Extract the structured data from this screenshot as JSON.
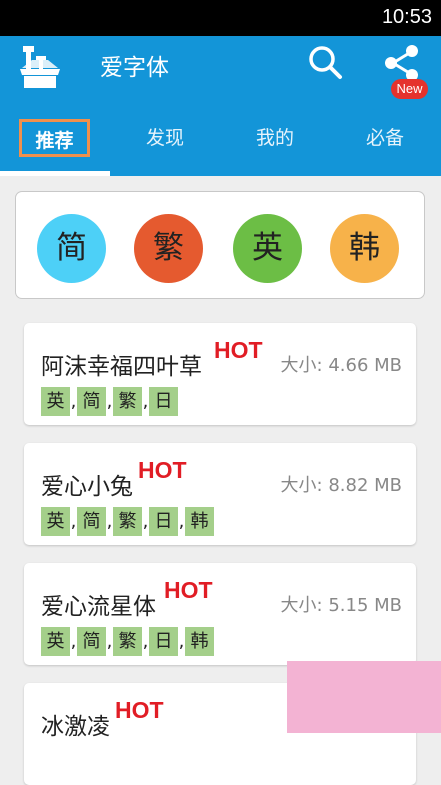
{
  "status_bar": {
    "time": "10:53"
  },
  "app_bar": {
    "title": "爱字体",
    "logo_icon": "font-box-icon",
    "search_icon": "search-icon",
    "share_icon": "share-icon"
  },
  "tabs": [
    {
      "label": "推荐",
      "active": true
    },
    {
      "label": "发现",
      "active": false
    },
    {
      "label": "我的",
      "active": false
    },
    {
      "label": "必备",
      "active": false,
      "badge": "New"
    }
  ],
  "filters": [
    {
      "label": "简",
      "color": "#4dd0f7"
    },
    {
      "label": "繁",
      "color": "#e55a2f"
    },
    {
      "label": "英",
      "color": "#6cbe45"
    },
    {
      "label": "韩",
      "color": "#f7b24a"
    }
  ],
  "fonts": [
    {
      "name": "阿沫幸福四叶草",
      "hot": "HOT",
      "size": "大小: 4.66 MB",
      "langs": [
        "英",
        "简",
        "繁",
        "日"
      ]
    },
    {
      "name": "爱心小兔",
      "hot": "HOT",
      "size": "大小: 8.82 MB",
      "langs": [
        "英",
        "简",
        "繁",
        "日",
        "韩"
      ]
    },
    {
      "name": "爱心流星体",
      "hot": "HOT",
      "size": "大小: 5.15 MB",
      "langs": [
        "英",
        "简",
        "繁",
        "日",
        "韩"
      ]
    },
    {
      "name": "冰激凌",
      "hot": "HOT",
      "size": "",
      "langs": []
    }
  ],
  "colors": {
    "primary": "#1395d8",
    "hot": "#e11d25",
    "lang_tag": "#a4cf8a",
    "active_tab_border": "#f0904c"
  }
}
